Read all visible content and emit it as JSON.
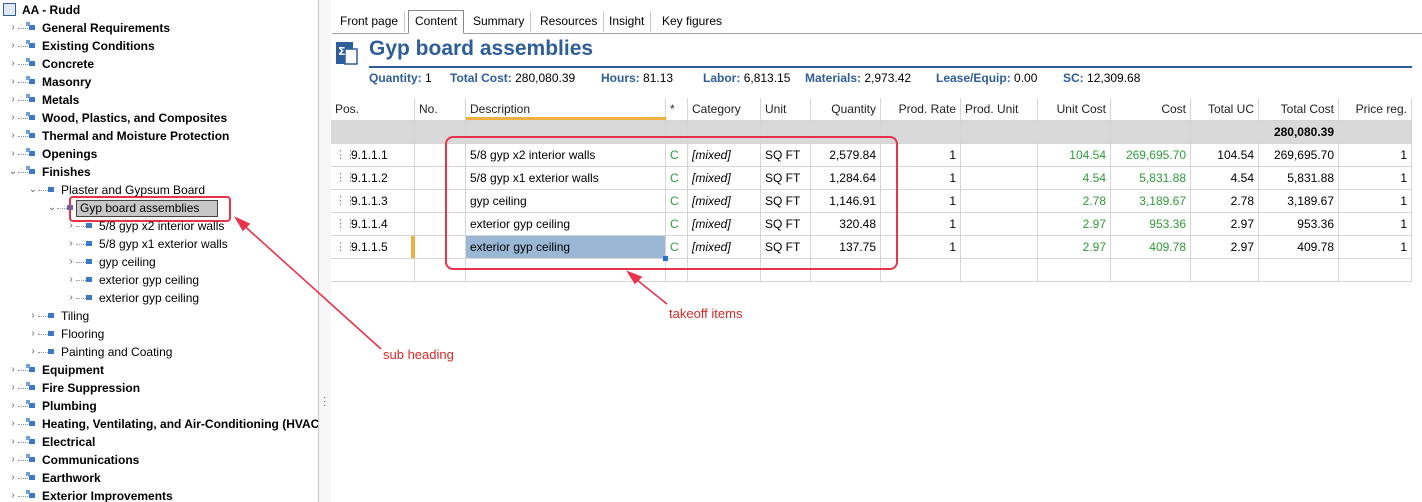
{
  "tree": {
    "root": "AA - Rudd",
    "items": [
      {
        "label": "General Requirements",
        "bold": true
      },
      {
        "label": "Existing Conditions",
        "bold": true
      },
      {
        "label": "Concrete",
        "bold": true
      },
      {
        "label": "Masonry",
        "bold": true
      },
      {
        "label": "Metals",
        "bold": true
      },
      {
        "label": "Wood, Plastics, and Composites",
        "bold": true
      },
      {
        "label": "Thermal and Moisture Protection",
        "bold": true
      },
      {
        "label": "Openings",
        "bold": true
      },
      {
        "label": "Finishes",
        "bold": true
      },
      {
        "label": "Plaster and Gypsum Board",
        "bold": false
      },
      {
        "label": "Gyp board assemblies",
        "bold": false
      },
      {
        "label": "5/8 gyp x2 interior walls",
        "bold": false
      },
      {
        "label": "5/8 gyp x1 exterior walls",
        "bold": false
      },
      {
        "label": "gyp ceiling",
        "bold": false
      },
      {
        "label": "exterior gyp ceiling",
        "bold": false
      },
      {
        "label": "exterior gyp ceiling",
        "bold": false
      },
      {
        "label": "Tiling",
        "bold": false
      },
      {
        "label": "Flooring",
        "bold": false
      },
      {
        "label": "Painting and Coating",
        "bold": false
      },
      {
        "label": "Equipment",
        "bold": true
      },
      {
        "label": "Fire Suppression",
        "bold": true
      },
      {
        "label": "Plumbing",
        "bold": true
      },
      {
        "label": "Heating, Ventilating, and Air-Conditioning (HVAC)",
        "bold": true
      },
      {
        "label": "Electrical",
        "bold": true
      },
      {
        "label": "Communications",
        "bold": true
      },
      {
        "label": "Earthwork",
        "bold": true
      },
      {
        "label": "Exterior Improvements",
        "bold": true
      }
    ]
  },
  "tabs": [
    "Front page",
    "Content",
    "Summary",
    "Resources",
    "Insight",
    "Key figures"
  ],
  "active_tab": "Content",
  "header": {
    "title": "Gyp board assemblies",
    "stats": [
      {
        "label": "Quantity:",
        "value": "1"
      },
      {
        "label": "Total Cost:",
        "value": "280,080.39"
      },
      {
        "label": "Hours:",
        "value": "81.13"
      },
      {
        "label": "Labor:",
        "value": "6,813.15"
      },
      {
        "label": "Materials:",
        "value": "2,973.42"
      },
      {
        "label": "Lease/Equip:",
        "value": "0.00"
      },
      {
        "label": "SC:",
        "value": "12,309.68"
      }
    ]
  },
  "grid": {
    "columns": [
      "Pos.",
      "No.",
      "Description",
      "*",
      "Category",
      "Unit",
      "Quantity",
      "Prod. Rate",
      "Prod. Unit",
      "Unit Cost",
      "Cost",
      "Total UC",
      "Total Cost",
      "Price reg."
    ],
    "group_total": "280,080.39",
    "rows": [
      {
        "pos": "9.1.1.1",
        "no": "",
        "desc": "5/8 gyp x2 interior walls",
        "star": "C",
        "category": "[mixed]",
        "unit": "SQ FT",
        "quantity": "2,579.84",
        "prod_rate": "1",
        "prod_unit": "",
        "unit_cost": "104.54",
        "cost": "269,695.70",
        "total_uc": "104.54",
        "total_cost": "269,695.70",
        "price_reg": "1"
      },
      {
        "pos": "9.1.1.2",
        "no": "",
        "desc": "5/8 gyp x1 exterior walls",
        "star": "C",
        "category": "[mixed]",
        "unit": "SQ FT",
        "quantity": "1,284.64",
        "prod_rate": "1",
        "prod_unit": "",
        "unit_cost": "4.54",
        "cost": "5,831.88",
        "total_uc": "4.54",
        "total_cost": "5,831.88",
        "price_reg": "1"
      },
      {
        "pos": "9.1.1.3",
        "no": "",
        "desc": "gyp ceiling",
        "star": "C",
        "category": "[mixed]",
        "unit": "SQ FT",
        "quantity": "1,146.91",
        "prod_rate": "1",
        "prod_unit": "",
        "unit_cost": "2.78",
        "cost": "3,189.67",
        "total_uc": "2.78",
        "total_cost": "3,189.67",
        "price_reg": "1"
      },
      {
        "pos": "9.1.1.4",
        "no": "",
        "desc": "exterior gyp ceiling",
        "star": "C",
        "category": "[mixed]",
        "unit": "SQ FT",
        "quantity": "320.48",
        "prod_rate": "1",
        "prod_unit": "",
        "unit_cost": "2.97",
        "cost": "953.36",
        "total_uc": "2.97",
        "total_cost": "953.36",
        "price_reg": "1"
      },
      {
        "pos": "9.1.1.5",
        "no": "",
        "desc": "exterior gyp ceiling",
        "star": "C",
        "category": "[mixed]",
        "unit": "SQ FT",
        "quantity": "137.75",
        "prod_rate": "1",
        "prod_unit": "",
        "unit_cost": "2.97",
        "cost": "409.78",
        "total_uc": "2.97",
        "total_cost": "409.78",
        "price_reg": "1"
      }
    ]
  },
  "annotations": {
    "sub_heading": "sub heading",
    "takeoff_items": "takeoff items"
  },
  "colors": {
    "accent": "#2e5e99",
    "highlight": "#e8334a",
    "positive": "#2f9a3a",
    "selection": "#9ab7d6"
  }
}
